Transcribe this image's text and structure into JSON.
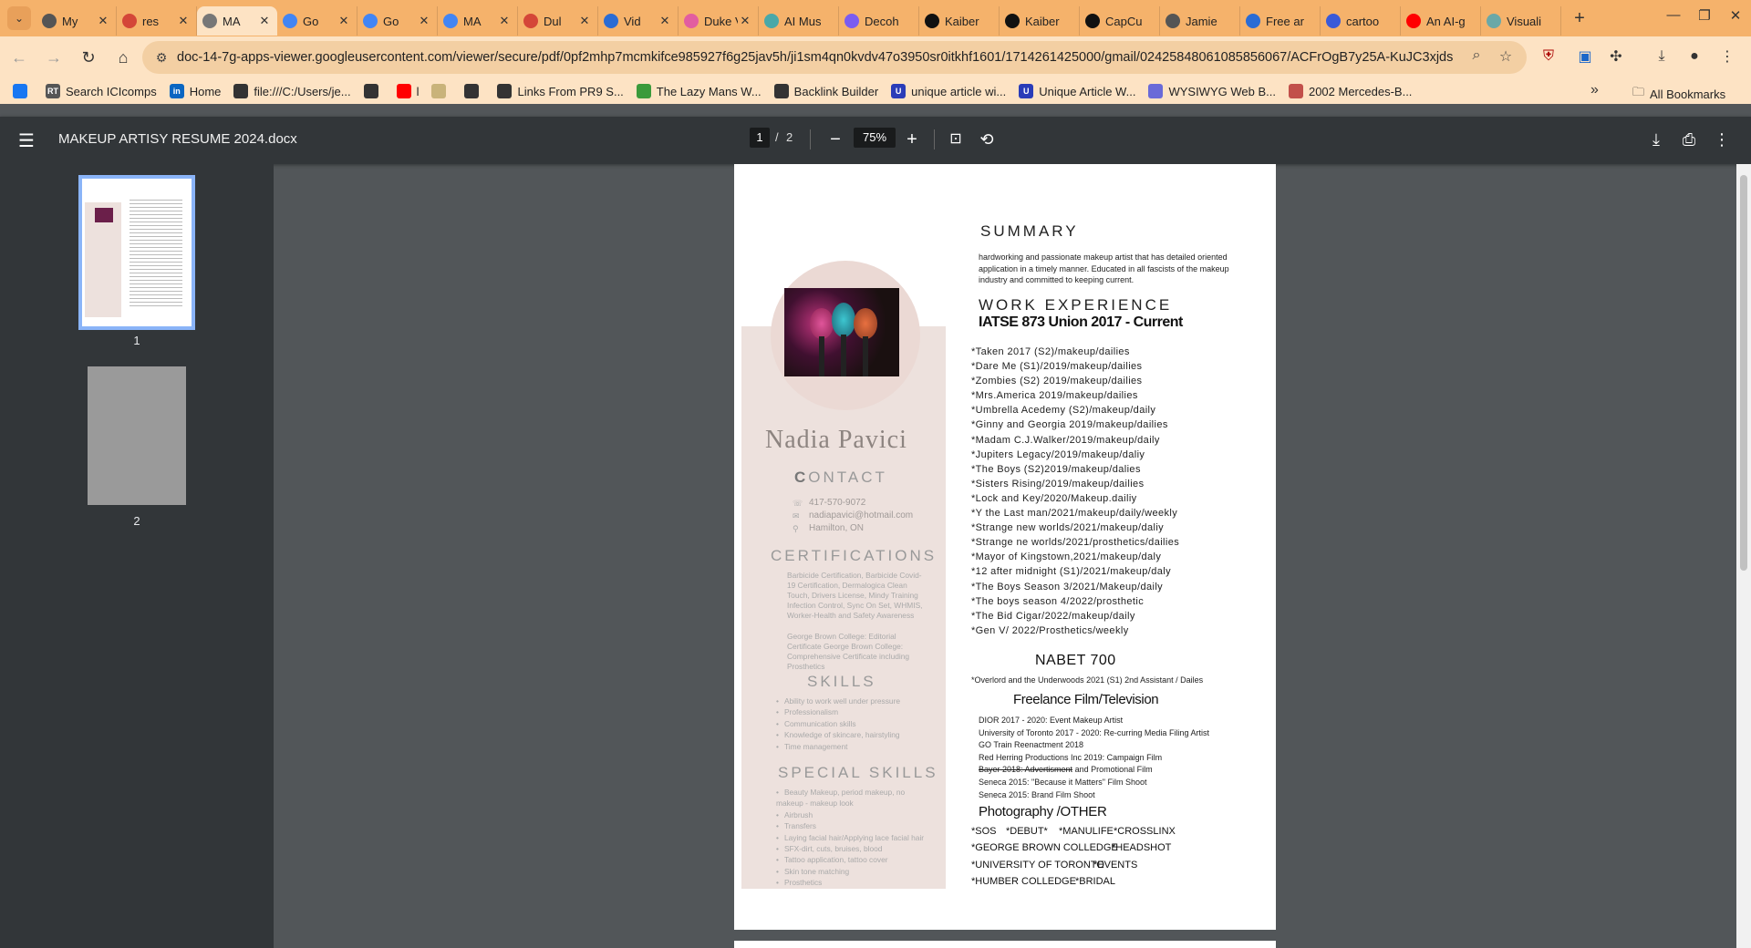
{
  "browser": {
    "tabs": [
      {
        "label": "My",
        "fav_color": "#555555"
      },
      {
        "label": "res",
        "fav_color": "#d44638"
      },
      {
        "label": "MA",
        "fav_color": "#777777",
        "active": true
      },
      {
        "label": "Go",
        "fav_color": "#4285f4"
      },
      {
        "label": "Go",
        "fav_color": "#4285f4"
      },
      {
        "label": "MA",
        "fav_color": "#4285f4"
      },
      {
        "label": "Dul",
        "fav_color": "#d44638"
      },
      {
        "label": "Vid",
        "fav_color": "#2b6cd4"
      },
      {
        "label": "Duke V",
        "fav_color": "#e25da0"
      },
      {
        "label": "AI Mus",
        "fav_color": "#4aa8a8"
      },
      {
        "label": "Decoh",
        "fav_color": "#7b5cf0"
      },
      {
        "label": "Kaiber",
        "fav_color": "#111111"
      },
      {
        "label": "Kaiber",
        "fav_color": "#111111"
      },
      {
        "label": "CapCu",
        "fav_color": "#111111"
      },
      {
        "label": "Jamie",
        "fav_color": "#555555"
      },
      {
        "label": "Free ar",
        "fav_color": "#2b6cd4"
      },
      {
        "label": "cartoo",
        "fav_color": "#3a5ad8"
      },
      {
        "label": "An AI-g",
        "fav_color": "#ff0000"
      },
      {
        "label": "Visuali",
        "fav_color": "#6aa8a8"
      }
    ],
    "url": "doc-14-7g-apps-viewer.googleusercontent.com/viewer/secure/pdf/0pf2mhp7mcmkifce985927f6g25jav5h/ji1sm4qn0kvdv47o3950sr0itkhf1601/1714261425000/gmail/02425848061085856067/ACFrOgB7y25A-KuJC3xjds...",
    "bookmarks": [
      {
        "label": "",
        "icon_color": "#1877f2"
      },
      {
        "label": "Search ICIcomps",
        "icon_color": "#555555",
        "icon_text": "RT"
      },
      {
        "label": "Home",
        "icon_color": "#0a66c2",
        "icon_text": "in"
      },
      {
        "label": "file:///C:/Users/je...",
        "icon_color": "#333333"
      },
      {
        "label": "",
        "icon_color": "#333333"
      },
      {
        "label": "l",
        "icon_color": "#ff0000"
      },
      {
        "label": "",
        "icon_color": "#c9b37a"
      },
      {
        "label": "",
        "icon_color": "#333333"
      },
      {
        "label": "Links From PR9 S...",
        "icon_color": "#333333"
      },
      {
        "label": "The Lazy Mans W...",
        "icon_color": "#3b9a3b"
      },
      {
        "label": "Backlink Builder",
        "icon_color": "#333333"
      },
      {
        "label": "unique article wi...",
        "icon_color": "#2a3cb8",
        "icon_text": "U"
      },
      {
        "label": "Unique Article W...",
        "icon_color": "#2a3cb8",
        "icon_text": "U"
      },
      {
        "label": "WYSIWYG Web B...",
        "icon_color": "#6a6ad8"
      },
      {
        "label": "2002 Mercedes-B...",
        "icon_color": "#c2504a"
      }
    ],
    "all_bookmarks": "All Bookmarks"
  },
  "viewer": {
    "title": "MAKEUP ARTISY RESUME 2024.docx",
    "page_current": "1",
    "page_sep": "/",
    "page_total": "2",
    "zoom": "75%",
    "thumb_labels": [
      "1",
      "2"
    ]
  },
  "resume": {
    "name": "Nadia Pavici",
    "contact_heading_first": "C",
    "contact_heading_rest": "ONTACT",
    "contact": {
      "phone": "417-570-9072",
      "email": "nadiapavici@hotmail.com",
      "location": "Hamilton, ON"
    },
    "certifications_heading": "CERTIFICATIONS",
    "certifications_1": "Barbicide Certification, Barbicide Covid-19 Certification, Dermalogica Clean Touch, Drivers License, Mindy Training Infection Control, Sync On Set, WHMIS, Worker-Health and Safety Awareness",
    "certifications_2": "George Brown College: Editorial Certificate George Brown College: Comprehensive Certificate including Prosthetics",
    "skills_heading": "SKILLS",
    "skills": [
      "Ability to work well under pressure",
      "Professionalism",
      "Communication skills",
      "Knowledge of skincare, hairstyling",
      "Time management"
    ],
    "special_heading": "SPECIAL SKILLS",
    "special_skills": [
      "Beauty Makeup, period makeup, no makeup - makeup look",
      "Airbrush",
      "Transfers",
      "Laying facial hair/Applying lace facial hair",
      "SFX-dirt, cuts, bruises, blood",
      "Tattoo application, tattoo cover",
      "Skin tone matching",
      "Prosthetics"
    ],
    "summary_heading": "SUMMARY",
    "summary": "hardworking and passionate makeup artist that has detailed oriented application in a timely manner.  Educated in all fascists of the makeup industry and committed to keeping current.",
    "work_heading": "WORK EXPERIENCE",
    "union": "IATSE 873 Union 2017 - Current",
    "jobs": [
      "*Taken 2017 (S2)/makeup/dailies",
      "*Dare Me (S1)/2019/makeup/dailies",
      "*Zombies (S2) 2019/makeup/dailies",
      "*Mrs.America 2019/makeup/dailies",
      "*Umbrella Acedemy (S2)/makeup/daily",
      "*Ginny and Georgia 2019/makeup/dailies",
      "*Madam C.J.Walker/2019/makeup/daily",
      "*Jupiters Legacy/2019/makeup/daliy",
      "*The Boys (S2)2019/makeup/dalies",
      "*Sisters Rising/2019/makeup/dailies",
      "*Lock and Key/2020/Makeup.dailiy",
      "*Y the Last man/2021/makeup/daily/weekly",
      "*Strange new worlds/2021/makeup/daliy",
      "*Strange ne worlds/2021/prosthetics/dailies",
      "*Mayor of Kingstown,2021/makeup/daly",
      "*12 after midnight (S1)/2021/makeup/daly",
      "*The Boys Season 3/2021/Makeup/daily",
      "*The boys season 4/2022/prosthetic",
      "*The Bid Cigar/2022/makeup/daily",
      "*Gen V/ 2022/Prosthetics/weekly"
    ],
    "nabet_heading": "NABET 700",
    "nabet_line": "*Overlord and the Underwoods 2021 (S1) 2nd Assistant / Dailes",
    "freelance_heading": "Freelance Film/Television",
    "freelance": [
      "DIOR 2017 - 2020: Event Makeup Artist",
      "University of Toronto 2017 - 2020: Re-curring Media Filing Artist",
      "GO Train Reenactment 2018",
      "Red Herring Productions Inc 2019: Campaign Film",
      "Bayer 2018: Advertisment and Promotional Film",
      "Seneca 2015: \"Because it Matters\" Film Shoot",
      "Seneca 2015: Brand Film Shoot"
    ],
    "photo_heading": "Photography /OTHER",
    "other": [
      [
        "*SOS",
        "*DEBUT*",
        "*MANULIFE",
        "*CROSSLINX"
      ],
      [
        "*GEORGE BROWN COLLEDGE",
        "*HEADSHOT"
      ],
      [
        "*UNIVERSITY OF TORONTO",
        "*EVENTS"
      ],
      [
        "*HUMBER COLLEDGE",
        "*BRIDAL"
      ]
    ]
  }
}
